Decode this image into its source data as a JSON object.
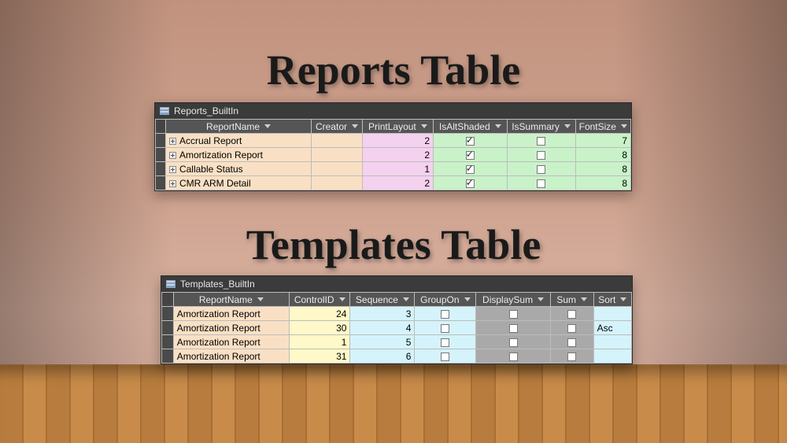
{
  "titles": {
    "reports": "Reports Table",
    "templates": "Templates Table"
  },
  "reports_window": {
    "title": "Reports_BuiltIn",
    "columns": [
      "ReportName",
      "Creator",
      "PrintLayout",
      "IsAltShaded",
      "IsSummary",
      "FontSize"
    ],
    "rows": [
      {
        "name": "Accrual Report",
        "creator": "",
        "print": "2",
        "alt": true,
        "sum": false,
        "font": "7"
      },
      {
        "name": "Amortization Report",
        "creator": "",
        "print": "2",
        "alt": true,
        "sum": false,
        "font": "8"
      },
      {
        "name": "Callable Status",
        "creator": "",
        "print": "1",
        "alt": true,
        "sum": false,
        "font": "8"
      },
      {
        "name": "CMR ARM Detail",
        "creator": "",
        "print": "2",
        "alt": true,
        "sum": false,
        "font": "8"
      }
    ]
  },
  "templates_window": {
    "title": "Templates_BuiltIn",
    "columns": [
      "ReportName",
      "ControlID",
      "Sequence",
      "GroupOn",
      "DisplaySum",
      "Sum",
      "Sort"
    ],
    "rows": [
      {
        "name": "Amortization Report",
        "cid": "24",
        "seq": "3",
        "grp": false,
        "dsp": false,
        "summ": false,
        "sort": ""
      },
      {
        "name": "Amortization Report",
        "cid": "30",
        "seq": "4",
        "grp": false,
        "dsp": false,
        "summ": false,
        "sort": "Asc"
      },
      {
        "name": "Amortization Report",
        "cid": "1",
        "seq": "5",
        "grp": false,
        "dsp": false,
        "summ": false,
        "sort": ""
      },
      {
        "name": "Amortization Report",
        "cid": "31",
        "seq": "6",
        "grp": false,
        "dsp": false,
        "summ": false,
        "sort": ""
      }
    ]
  }
}
